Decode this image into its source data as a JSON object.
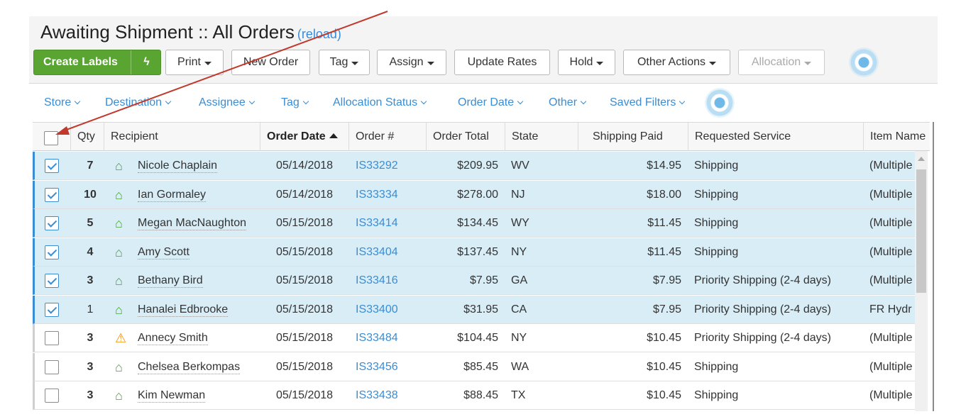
{
  "header": {
    "title": "Awaiting Shipment :: All Orders",
    "reload_label": "(reload)"
  },
  "toolbar": {
    "create_labels": "Create Labels",
    "print": "Print",
    "new_order": "New Order",
    "tag": "Tag",
    "assign": "Assign",
    "update_rates": "Update Rates",
    "hold": "Hold",
    "other_actions": "Other Actions",
    "allocation": "Allocation"
  },
  "filters": {
    "store": "Store",
    "destination": "Destination",
    "assignee": "Assignee",
    "tag": "Tag",
    "allocation_status": "Allocation Status",
    "order_date": "Order Date",
    "other": "Other",
    "saved_filters": "Saved Filters"
  },
  "columns": {
    "qty": "Qty",
    "recipient": "Recipient",
    "order_date": "Order Date",
    "order_no": "Order #",
    "order_total": "Order Total",
    "state": "State",
    "shipping_paid": "Shipping Paid",
    "requested_service": "Requested Service",
    "item_name": "Item Name"
  },
  "rows": [
    {
      "selected": true,
      "qty": "7",
      "qty_bold": true,
      "icon": "home-icon",
      "recipient": "Nicole Chaplain",
      "date": "05/14/2018",
      "order": "IS33292",
      "total": "$209.95",
      "state": "WV",
      "shipping": "$14.95",
      "service": "Shipping",
      "item": "(Multiple"
    },
    {
      "selected": true,
      "qty": "10",
      "qty_bold": true,
      "icon": "home-icon",
      "recipient": "Ian Gormaley",
      "date": "05/14/2018",
      "order": "IS33334",
      "total": "$278.00",
      "state": "NJ",
      "shipping": "$18.00",
      "service": "Shipping",
      "item": "(Multiple"
    },
    {
      "selected": true,
      "qty": "5",
      "qty_bold": true,
      "icon": "home-icon",
      "recipient": "Megan MacNaughton",
      "date": "05/15/2018",
      "order": "IS33414",
      "total": "$134.45",
      "state": "WY",
      "shipping": "$11.45",
      "service": "Shipping",
      "item": "(Multiple"
    },
    {
      "selected": true,
      "qty": "4",
      "qty_bold": true,
      "icon": "home-icon",
      "recipient": "Amy Scott",
      "date": "05/15/2018",
      "order": "IS33404",
      "total": "$137.45",
      "state": "NY",
      "shipping": "$11.45",
      "service": "Shipping",
      "item": "(Multiple"
    },
    {
      "selected": true,
      "qty": "3",
      "qty_bold": true,
      "icon": "home-icon",
      "recipient": "Bethany Bird",
      "date": "05/15/2018",
      "order": "IS33416",
      "total": "$7.95",
      "state": "GA",
      "shipping": "$7.95",
      "service": "Priority Shipping (2-4 days)",
      "item": "(Multiple"
    },
    {
      "selected": true,
      "qty": "1",
      "qty_bold": false,
      "icon": "home-icon",
      "recipient": "Hanalei Edbrooke",
      "date": "05/15/2018",
      "order": "IS33400",
      "total": "$31.95",
      "state": "CA",
      "shipping": "$7.95",
      "service": "Priority Shipping (2-4 days)",
      "item": "FR Hydr"
    },
    {
      "selected": false,
      "qty": "3",
      "qty_bold": true,
      "icon": "warning-icon",
      "recipient": "Annecy Smith",
      "date": "05/15/2018",
      "order": "IS33484",
      "total": "$104.45",
      "state": "NY",
      "shipping": "$10.45",
      "service": "Priority Shipping (2-4 days)",
      "item": "(Multiple"
    },
    {
      "selected": false,
      "qty": "3",
      "qty_bold": true,
      "icon": "home-icon",
      "recipient": "Chelsea Berkompas",
      "date": "05/15/2018",
      "order": "IS33456",
      "total": "$85.45",
      "state": "WA",
      "shipping": "$10.45",
      "service": "Shipping",
      "item": "(Multiple"
    },
    {
      "selected": false,
      "qty": "3",
      "qty_bold": true,
      "icon": "home-icon",
      "recipient": "Kim Newman",
      "date": "05/15/2018",
      "order": "IS33438",
      "total": "$88.45",
      "state": "TX",
      "shipping": "$10.45",
      "service": "Shipping",
      "item": "(Multiple"
    }
  ],
  "colors": {
    "accent": "#3a8dd4",
    "create_green": "#5aa532",
    "selected_row": "#d9edf7",
    "annotation_arrow": "#c0392b"
  }
}
